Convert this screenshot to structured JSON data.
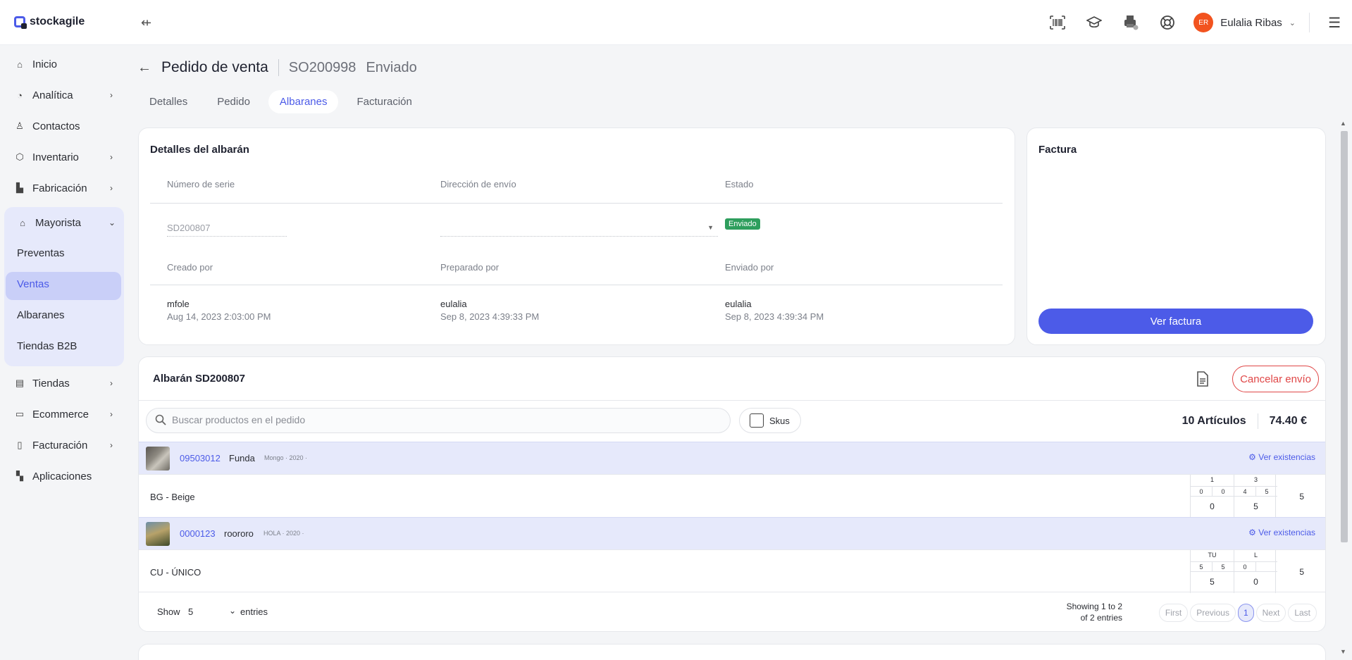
{
  "app": {
    "name": "stockagile"
  },
  "header": {
    "user_name": "Eulalia Ribas",
    "user_initials": "ER",
    "avatar_color": "#f2531f",
    "icons": [
      "barcode-icon",
      "graduation-cap-icon",
      "printer-icon",
      "lifebuoy-icon"
    ]
  },
  "sidebar": {
    "items": [
      {
        "label": "Inicio",
        "icon": "home-icon"
      },
      {
        "label": "Analítica",
        "icon": "analytics-icon"
      },
      {
        "label": "Contactos",
        "icon": "user-icon"
      },
      {
        "label": "Inventario",
        "icon": "box-icon"
      },
      {
        "label": "Fabricación",
        "icon": "factory-icon"
      },
      {
        "label": "Mayorista",
        "icon": "warehouse-icon"
      },
      {
        "label": "Tiendas",
        "icon": "store-icon"
      },
      {
        "label": "Ecommerce",
        "icon": "laptop-icon"
      },
      {
        "label": "Facturación",
        "icon": "invoice-icon"
      },
      {
        "label": "Aplicaciones",
        "icon": "apps-icon"
      }
    ],
    "mayorista_sub": [
      "Preventas",
      "Ventas",
      "Albaranes",
      "Tiendas B2B"
    ],
    "active_sub": "Ventas"
  },
  "page": {
    "title": "Pedido de venta",
    "code": "SO200998",
    "state": "Enviado"
  },
  "tabs": [
    "Detalles",
    "Pedido",
    "Albaranes",
    "Facturación"
  ],
  "active_tab": "Albaranes",
  "details": {
    "title": "Detalles del albarán",
    "serial_label": "Número de serie",
    "address_label": "Dirección de envío",
    "state_label": "Estado",
    "serial_value": "SD200807",
    "state_badge": "Enviado",
    "state_color": "#2e9e5d",
    "created_label": "Creado por",
    "prepared_label": "Preparado por",
    "sent_label": "Enviado por",
    "created_by": "mfole",
    "created_at": "Aug 14, 2023 2:03:00 PM",
    "prepared_by": "eulalia",
    "prepared_at": "Sep 8, 2023 4:39:33 PM",
    "sent_by": "eulalia",
    "sent_at": "Sep 8, 2023 4:39:34 PM"
  },
  "invoice": {
    "title": "Factura",
    "button": "Ver factura",
    "accent": "#4c5be8"
  },
  "albaran": {
    "title": "Albarán SD200807",
    "cancel_button": "Cancelar envío",
    "search_placeholder": "Buscar productos en el pedido",
    "skus_label": "Skus",
    "items_count": "10 Artículos",
    "total": "74.40 €",
    "stock_link": "Ver existencias",
    "products": [
      {
        "code": "09503012",
        "name": "Funda",
        "meta": "Mongo · 2020 ·",
        "variant": "BG - Beige",
        "sizes": [
          {
            "label": "1",
            "subs": [
              "0",
              "0"
            ],
            "qty": "0"
          },
          {
            "label": "3",
            "subs": [
              "4",
              "5"
            ],
            "qty": "5"
          }
        ],
        "total": "5"
      },
      {
        "code": "0000123",
        "name": "roororo",
        "meta": "HOLA · 2020 ·",
        "variant": "CU - ÚNICO",
        "sizes": [
          {
            "label": "TU",
            "subs": [
              "5",
              "5"
            ],
            "qty": "5"
          },
          {
            "label": "L",
            "subs": [
              "0",
              ""
            ],
            "qty": "0"
          }
        ],
        "total": "5"
      }
    ],
    "footer": {
      "show_label": "Show",
      "show_value": "5",
      "entries_label": "entries",
      "showing_line1": "Showing 1 to 2",
      "showing_line2": "of 2 entries",
      "pager": [
        "First",
        "Previous",
        "1",
        "Next",
        "Last"
      ]
    }
  }
}
